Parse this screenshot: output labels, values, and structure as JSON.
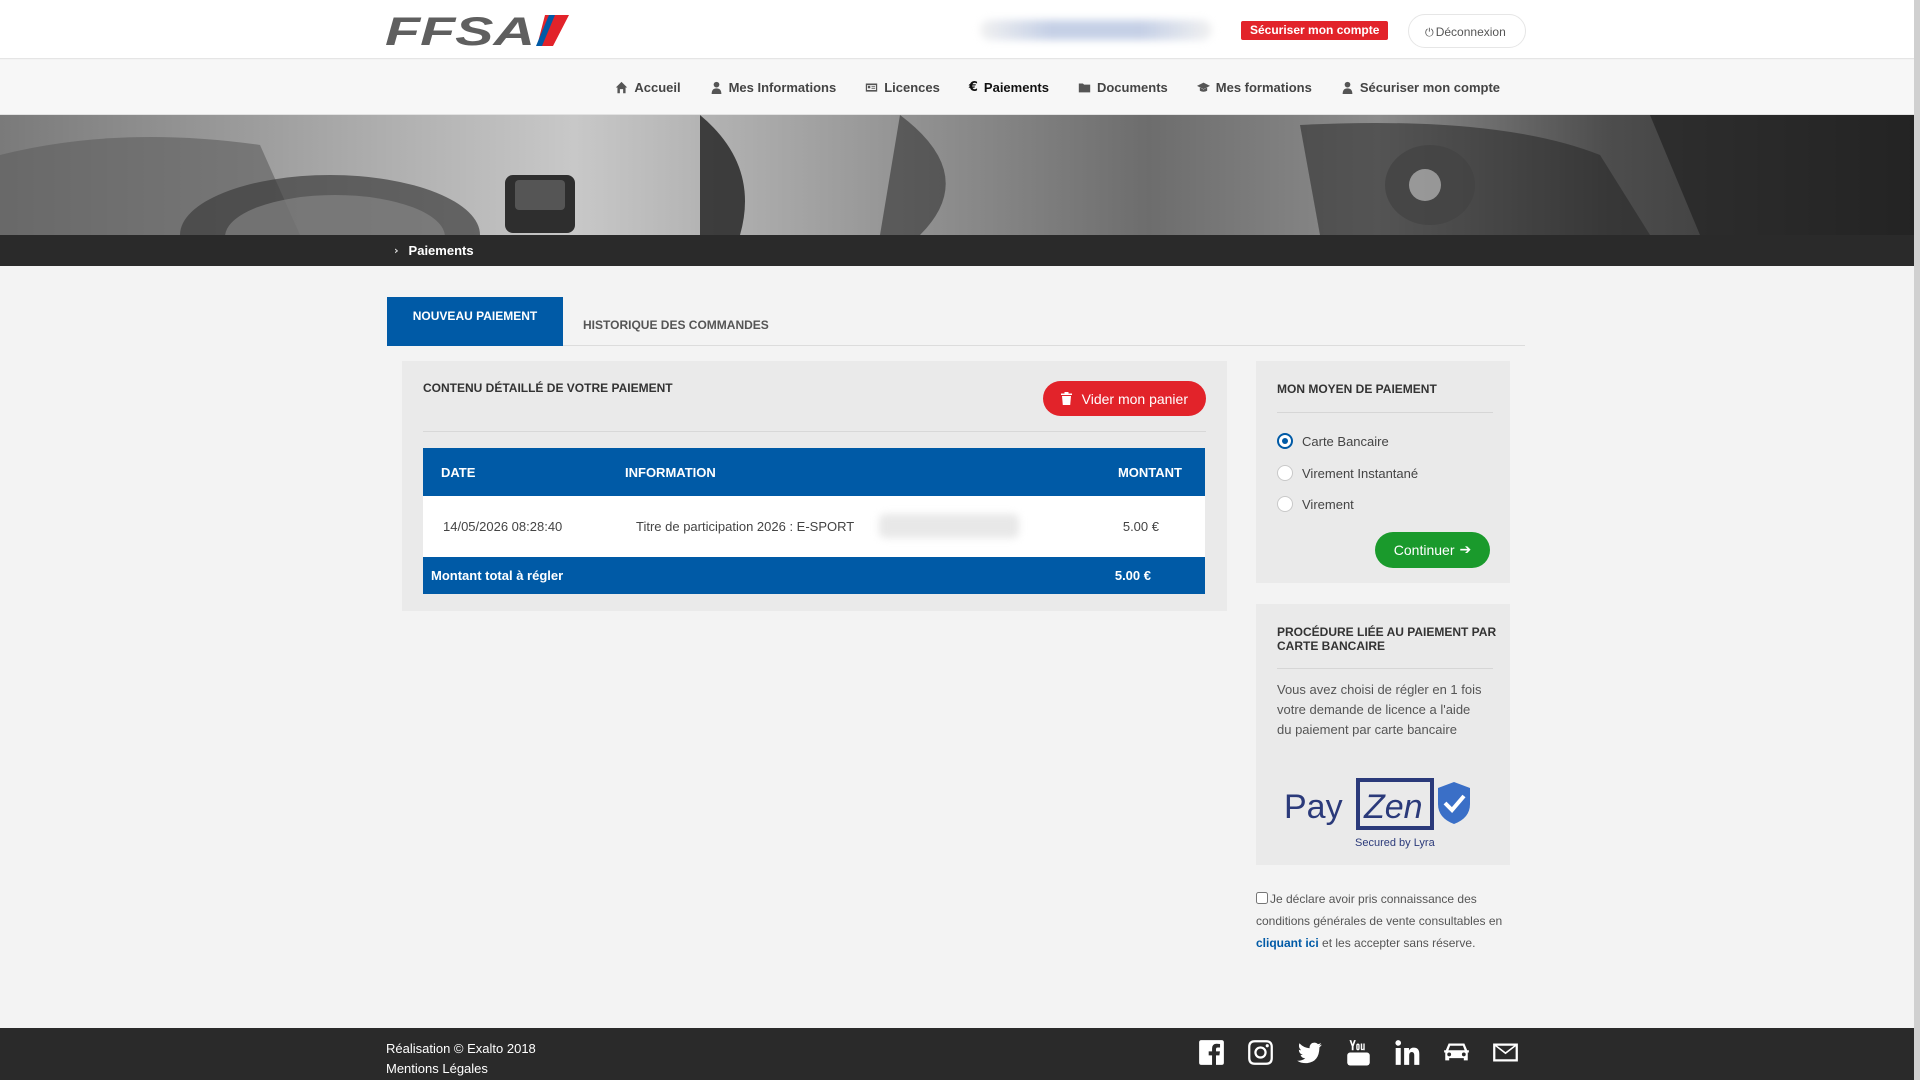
{
  "header": {
    "logo_text": "FFSA",
    "secure_label": "Sécuriser mon compte",
    "logout_label": "Déconnexion"
  },
  "nav": {
    "items": [
      {
        "label": "Accueil",
        "icon": "home-icon"
      },
      {
        "label": "Mes Informations",
        "icon": "user-icon"
      },
      {
        "label": "Licences",
        "icon": "id-card-icon"
      },
      {
        "label": "Paiements",
        "icon": "euro-icon",
        "active": true
      },
      {
        "label": "Documents",
        "icon": "folder-icon"
      },
      {
        "label": "Mes formations",
        "icon": "graduation-cap-icon"
      },
      {
        "label": "Sécuriser mon compte",
        "icon": "user-icon"
      }
    ]
  },
  "breadcrumb": {
    "current": "Paiements"
  },
  "tabs": {
    "active": "NOUVEAU PAIEMENT",
    "other": "HISTORIQUE DES COMMANDES"
  },
  "payment_panel": {
    "title": "CONTENU DÉTAILLÉ DE VOTRE PAIEMENT",
    "empty_cart_label": "Vider mon panier",
    "columns": {
      "date": "DATE",
      "information": "INFORMATION",
      "amount": "MONTANT"
    },
    "rows": [
      {
        "date": "14/05/2026 08:28:40",
        "information": "Titre de participation 2026 : E-SPORT",
        "amount": "5.00 €"
      }
    ],
    "total_label": "Montant total à régler",
    "total_value": "5.00 €"
  },
  "payment_method": {
    "title": "MON MOYEN DE PAIEMENT",
    "options": [
      {
        "label": "Carte Bancaire",
        "selected": true
      },
      {
        "label": "Virement Instantané",
        "selected": false
      },
      {
        "label": "Virement",
        "selected": false
      }
    ],
    "continue_label": "Continuer"
  },
  "procedure": {
    "title": "PROCÉDURE LIÉE AU PAIEMENT PAR CARTE BANCAIRE",
    "text": "Vous avez choisi de régler en 1 fois votre demande de licence a l'aide du paiement par carte bancaire",
    "payzen_pay": "Pay",
    "payzen_zen": "Zen",
    "payzen_tagline": "Secured by Lyra"
  },
  "cgv": {
    "text_before": "Je déclare avoir pris connaissance des conditions générales de vente consultables en ",
    "link": "cliquant ici",
    "text_after": " et les accepter sans réserve."
  },
  "footer": {
    "credit": "Réalisation © Exalto 2018",
    "legal": "Mentions Légales",
    "social_icons": [
      "facebook-icon",
      "instagram-icon",
      "twitter-icon",
      "youtube-icon",
      "linkedin-icon",
      "car-icon",
      "mail-icon"
    ]
  },
  "colors": {
    "primary_blue": "#005aa6",
    "danger_red": "#e2232a",
    "success_green": "#1a9a2c",
    "dark_bar": "#2a2a2a"
  }
}
